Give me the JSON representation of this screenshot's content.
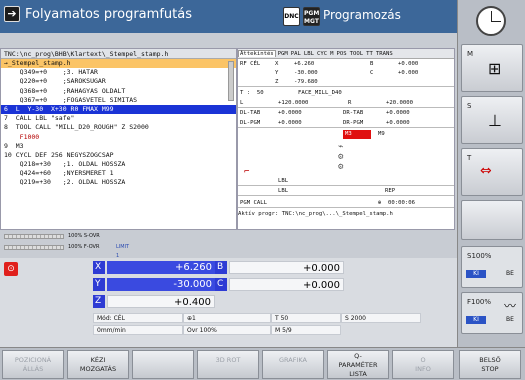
{
  "header": {
    "arrow_icon": "arrow-right",
    "title": "Folyamatos programfutás",
    "dnc": "DNC",
    "pgm_icon": "PGM MGT",
    "mode2": "Programozás"
  },
  "program": {
    "path": "TNC:\\nc_prog\\BHB\\Klartext\\_Stempel_stamp.h",
    "lines": [
      "→_Stempel_stamp.h",
      "    Q349=+0    ;3. HATAR",
      "    Q220=+0    ;SAROKSUGAR",
      "    Q368=+0    ;RAHAGYAS OLDALT",
      "    Q367=+0    ;FOGASVETEL SIMITAS",
      "6  L  Y-30  X+30 R0 FMAX M99",
      "7  CALL LBL \"safe\"",
      "8  TOOL CALL \"MILL_D20_ROUGH\" Z S2000",
      "    F1000",
      "9  M3",
      "10 CYCL DEF 256 NEGYSZOGCSAP",
      "    Q218=+30   ;1. OLDAL HOSSZA",
      "    Q424=+60   ;NYERSMERET 1",
      "    Q219=+30   ;2. OLDAL HOSSZA"
    ]
  },
  "status": {
    "tabs": [
      "Áttekintés",
      "PGM",
      "PAL",
      "LBL",
      "CYC",
      "M",
      "POS",
      "TOOL",
      "TT",
      "TRANS"
    ],
    "rf": "RF CÉL",
    "x": "+6.260",
    "y": "-30.000",
    "z": "-79.680",
    "b": "+0.000",
    "c": "+0.000",
    "t": "T :  50",
    "tool_name": "FACE_MILL_D40",
    "l": "+120.0000",
    "r": "+20.0000",
    "dl_tab": "+0.0000",
    "dr_tab": "+0.0000",
    "dl_pgm": "+0.0000",
    "dr_pgm": "+0.0000",
    "m3": "M3",
    "m9": "M9",
    "lbl": "LBL",
    "rep": "REP",
    "pgm_call": "PGM CALL",
    "time": "00:00:06",
    "active": "Aktív progr: TNC:\\nc_prog\\...\\_Stempel_stamp.h"
  },
  "overrides": {
    "s_ovr": "100% S-OVR",
    "f_ovr": "100% F-OVR",
    "limit": "LIMIT 1"
  },
  "positions": {
    "x_label": "X",
    "x_val": "+6.260",
    "b_label": "B",
    "b_val": "+0.000",
    "y_label": "Y",
    "y_val": "-30.000",
    "c_label": "C",
    "c_val": "+0.000",
    "z_label": "Z",
    "z_val": "+0.400",
    "mode": "Mód: CÉL",
    "t": "T 50",
    "s": "S 2000",
    "f": "0mm/min",
    "ovr": "Ovr 100%",
    "m": "M 5/9"
  },
  "right_panel": {
    "m": "M",
    "s": "S",
    "t": "T",
    "s100": "S100%",
    "f100": "F100%",
    "ki": "KI",
    "be": "BE"
  },
  "softkeys": [
    {
      "l1": "POZICIONÁ",
      "l2": "ÁLLÁS",
      "enabled": false
    },
    {
      "l1": "KÉZI",
      "l2": "MOZGATÁS",
      "enabled": true
    },
    {
      "l1": "",
      "l2": "",
      "enabled": true
    },
    {
      "l1": "3D ROT",
      "l2": "",
      "enabled": false
    },
    {
      "l1": "GRAFIKA",
      "l2": "",
      "enabled": false
    },
    {
      "l1": "Q-",
      "l2": "PARAMÉTER",
      "l3": "LISTA",
      "enabled": true
    },
    {
      "l1": "O",
      "l2": "INFO",
      "enabled": false
    },
    {
      "l1": "BELSŐ",
      "l2": "STOP",
      "enabled": true
    }
  ],
  "colors": {
    "header_blue": "#3c6799",
    "highlight": "#1a33d6",
    "axis_blue": "#3a4ae0"
  }
}
